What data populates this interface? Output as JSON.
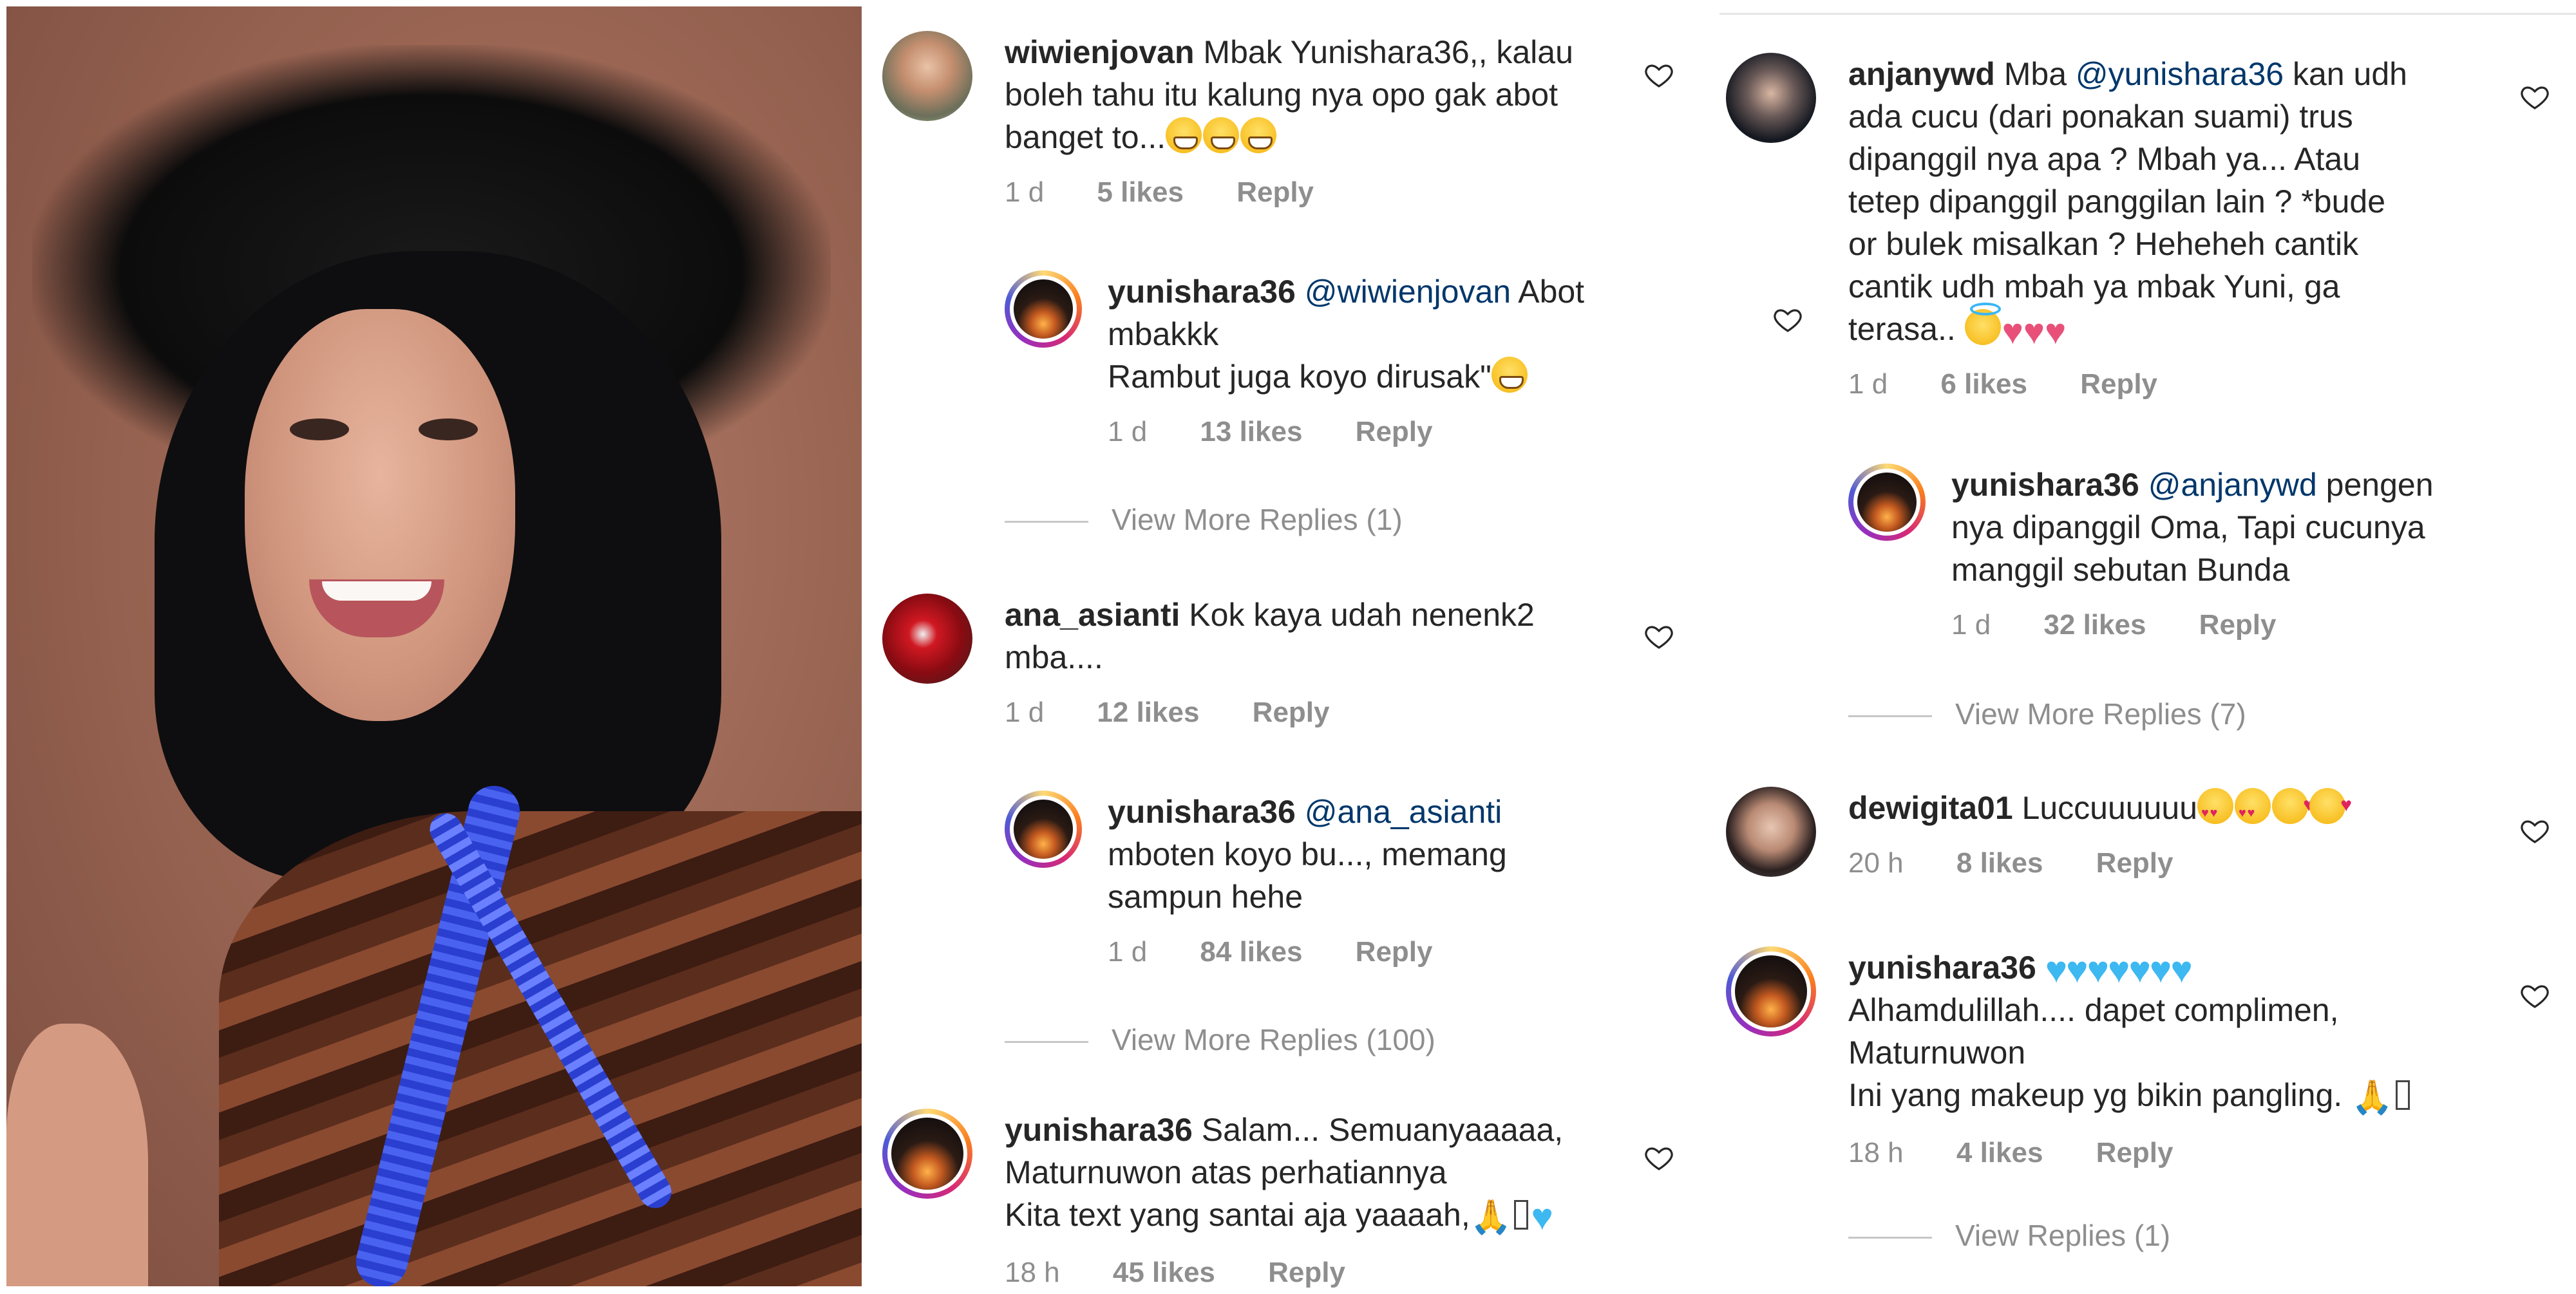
{
  "colors": {
    "username": "#262626",
    "mention": "#00376b",
    "meta": "#8e8e8e",
    "heart_icon": "#262626"
  },
  "comments_left": [
    {
      "user": "wiwienjovan",
      "text_lines": [
        "Mbak Yunishara36,, kalau",
        "boleh tahu itu kalung nya opo gak abot",
        "banget to..."
      ],
      "emoji": [
        "grinning-face",
        "grinning-face",
        "grinning-face"
      ],
      "time": "1 d",
      "likes": "5 likes",
      "reply": "Reply"
    },
    {
      "user": "yunishara36",
      "mention": "@wiwienjovan",
      "text_lines": [
        "Abot",
        "mbakkk",
        "Rambut juga koyo dirusak\""
      ],
      "emoji": [
        "grinning-face"
      ],
      "time": "1 d",
      "likes": "13 likes",
      "reply": "Reply",
      "view_more": "View More Replies (1)"
    },
    {
      "user": "ana_asianti",
      "text_lines": [
        "Kok kaya udah nenenk2",
        "mba...."
      ],
      "time": "1 d",
      "likes": "12 likes",
      "reply": "Reply"
    },
    {
      "user": "yunishara36",
      "mention": "@ana_asianti",
      "text_lines": [
        "mboten koyo bu..., memang",
        "sampun hehe"
      ],
      "time": "1 d",
      "likes": "84 likes",
      "reply": "Reply",
      "view_more": "View More Replies (100)"
    },
    {
      "user": "yunishara36",
      "text_lines": [
        "Salam... Semuanyaaaaa,",
        "Maturnuwon atas perhatiannya",
        "Kita text yang santai aja yaaaah,"
      ],
      "emoji": [
        "folded-hands",
        "unknown-glyph",
        "blue-heart"
      ],
      "time": "18 h",
      "likes": "45 likes",
      "reply": "Reply"
    }
  ],
  "comments_right": [
    {
      "user": "anjanywd",
      "prefix": "Mba",
      "mention": "@yunishara36",
      "text_lines": [
        "kan udh",
        "ada cucu (dari ponakan suami) trus",
        "dipanggil nya apa ? Mbah ya... Atau",
        "tetep dipanggil panggilan lain ? *bude",
        "or bulek misalkan ? Heheheh cantik",
        "cantik udh mbah ya mbak Yuni, ga",
        "terasa.."
      ],
      "emoji": [
        "smiling-face-with-halo",
        "pink-heart",
        "pink-heart",
        "pink-heart"
      ],
      "time": "1 d",
      "likes": "6 likes",
      "reply": "Reply"
    },
    {
      "user": "yunishara36",
      "mention": "@anjanywd",
      "text_lines": [
        "pengen",
        "nya dipanggil Oma, Tapi cucunya",
        "manggil sebutan Bunda"
      ],
      "time": "1 d",
      "likes": "32 likes",
      "reply": "Reply",
      "view_more": "View More Replies (7)"
    },
    {
      "user": "dewigita01",
      "text_lines": [
        "Luccuuuuuu"
      ],
      "emoji": [
        "heart-eyes",
        "heart-eyes",
        "kissing-heart",
        "kissing-heart"
      ],
      "time": "20 h",
      "likes": "8 likes",
      "reply": "Reply"
    },
    {
      "user": "yunishara36",
      "emoji": [
        "blue-heart",
        "blue-heart",
        "blue-heart",
        "blue-heart",
        "blue-heart",
        "blue-heart",
        "blue-heart"
      ],
      "text_lines": [
        "Alhamdulillah.... dapet complimen,",
        "Maturnuwon",
        "Ini yang makeup yg bikin pangling."
      ],
      "emoji_end": [
        "folded-hands",
        "unknown-glyph"
      ],
      "time": "18 h",
      "likes": "4 likes",
      "reply": "Reply",
      "view_more": "View Replies (1)"
    }
  ],
  "glyphs": {
    "heart_blue": "♥",
    "heart_pink": "♥",
    "pray": "🙏"
  }
}
